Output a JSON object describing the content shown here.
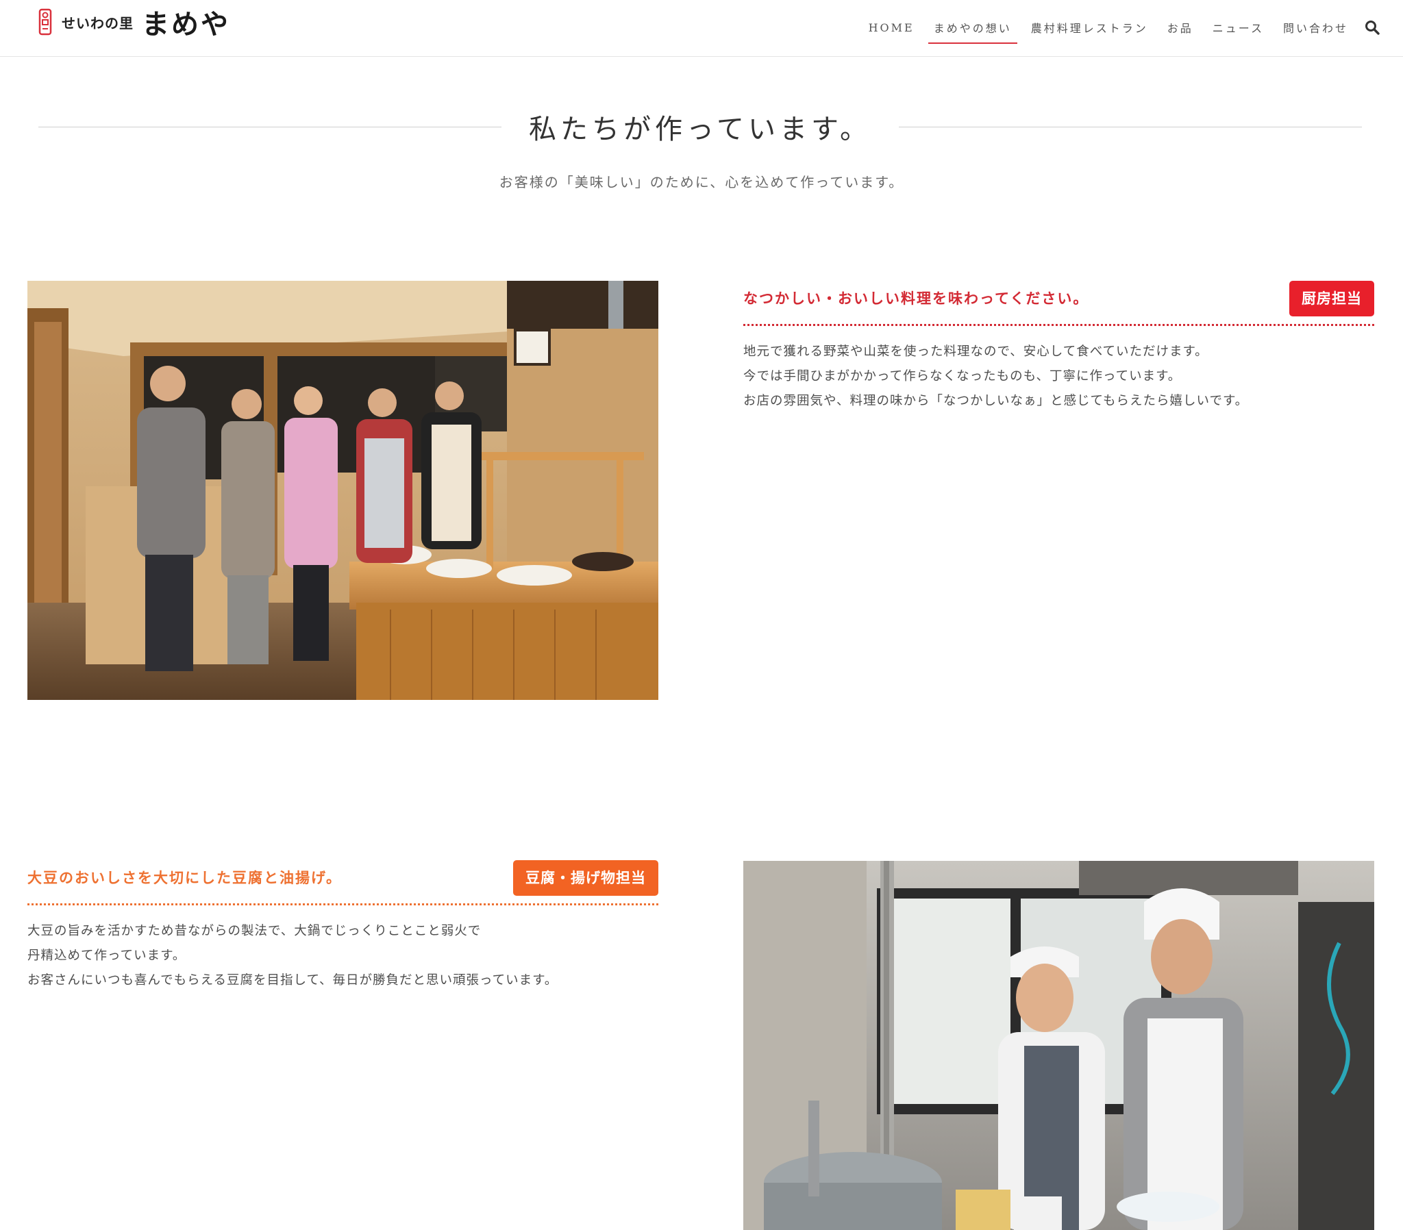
{
  "header": {
    "logo_small": "せいわの里",
    "logo_big": "まめや",
    "nav": [
      {
        "label": "HOME",
        "active": false
      },
      {
        "label": "まめやの想い",
        "active": true
      },
      {
        "label": "農村料理レストラン",
        "active": false
      },
      {
        "label": "お品",
        "active": false
      },
      {
        "label": "ニュース",
        "active": false
      },
      {
        "label": "問い合わせ",
        "active": false
      }
    ],
    "search_icon": "search-icon",
    "accent_color": "#d9313c"
  },
  "section": {
    "title": "私たちが作っています。",
    "subtitle": "お客様の「美味しい」のために、心を込めて作っています。"
  },
  "staff": [
    {
      "catch": "なつかしい・おいしい料理を味わってください。",
      "role": "厨房担当",
      "color": "#e8202b",
      "lines": [
        "地元で獲れる野菜や山菜を使った料理なので、安心して食べていただけます。",
        "今では手間ひまがかかって作らなくなったものも、丁寧に作っています。",
        "お店の雰囲気や、料理の味から「なつかしいなぁ」と感じてもらえたら嬉しいです。"
      ]
    },
    {
      "catch": "大豆のおいしさを大切にした豆腐と油揚げ。",
      "role": "豆腐・揚げ物担当",
      "color": "#f26323",
      "lines": [
        "大豆の旨みを活かすため昔ながらの製法で、大鍋でじっくりことこと弱火で",
        "丹精込めて作っています。",
        "お客さんにいつも喜んでもらえる豆腐を目指して、毎日が勝負だと思い頑張っています。"
      ]
    }
  ]
}
